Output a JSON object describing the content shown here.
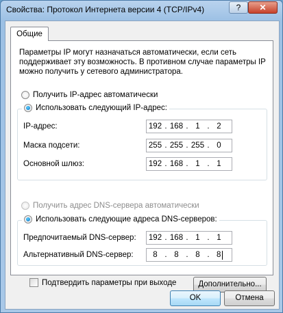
{
  "window": {
    "title": "Свойства: Протокол Интернета версии 4 (TCP/IPv4)",
    "help_label": "?",
    "close_label": "✕"
  },
  "tabs": [
    {
      "label": "Общие",
      "active": true
    }
  ],
  "general": {
    "description": "Параметры IP могут назначаться автоматически, если сеть поддерживает эту возможность. В противном случае параметры IP можно получить у сетевого администратора.",
    "ip_auto_label": "Получить IP-адрес автоматически",
    "ip_manual_label": "Использовать следующий IP-адрес:",
    "ip_mode": "manual",
    "ip_address": {
      "label": "IP-адрес:",
      "octets": [
        "192",
        "168",
        "1",
        "2"
      ]
    },
    "subnet_mask": {
      "label": "Маска подсети:",
      "octets": [
        "255",
        "255",
        "255",
        "0"
      ]
    },
    "gateway": {
      "label": "Основной шлюз:",
      "octets": [
        "192",
        "168",
        "1",
        "1"
      ]
    },
    "dns_auto_label": "Получить адрес DNS-сервера автоматически",
    "dns_manual_label": "Использовать следующие адреса DNS-серверов:",
    "dns_mode": "manual",
    "preferred_dns": {
      "label": "Предпочитаемый DNS-сервер:",
      "octets": [
        "192",
        "168",
        "1",
        "1"
      ]
    },
    "alternate_dns": {
      "label": "Альтернативный DNS-сервер:",
      "octets": [
        "8",
        "8",
        "8",
        "8"
      ]
    },
    "validate_label": "Подтвердить параметры при выходе",
    "validate_checked": false,
    "advanced_label": "Дополнительно..."
  },
  "footer": {
    "ok_label": "OK",
    "cancel_label": "Отмена"
  }
}
